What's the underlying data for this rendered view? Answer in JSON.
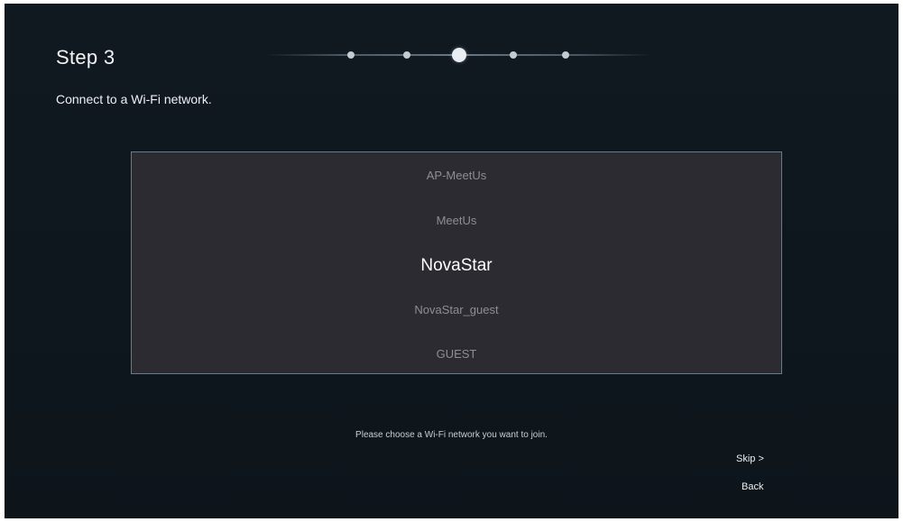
{
  "header": {
    "step_title": "Step 3",
    "subtitle": "Connect to a Wi-Fi network."
  },
  "progress": {
    "total_steps": 5,
    "current_step": 3
  },
  "network_list": {
    "items": [
      "AP-MeetUs",
      "MeetUs",
      "NovaStar",
      "NovaStar_guest",
      "GUEST"
    ],
    "selected": "NovaStar"
  },
  "footer": {
    "hint": "Please choose a Wi-Fi network you want to join.",
    "skip_label": "Skip >",
    "back_label": "Back"
  },
  "colors": {
    "background": "#101820",
    "list_background": "#2c2b31",
    "list_border": "#6c7a86",
    "selected_text": "#ffffff",
    "unselected_text": "#8d8e94"
  }
}
